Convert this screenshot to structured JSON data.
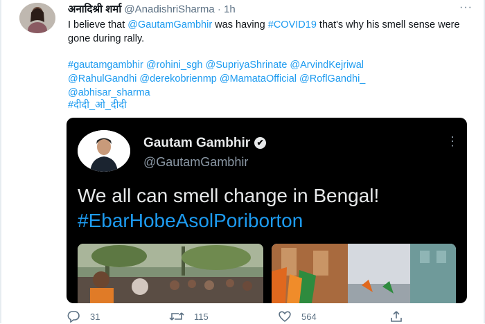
{
  "tweet": {
    "author_name": "अनादिश्री शर्मा",
    "handle": "@AnadishriSharma",
    "separator": "·",
    "time": "1h",
    "more": "···",
    "line1_pre": "I believe that ",
    "line1_mention": "@GautamGambhir",
    "line1_mid": " was having ",
    "line1_tag": "#COVID19",
    "line1_post": " that's why his smell sense were gone during rally.",
    "tags_line": [
      "#gautamgambhir @rohini_sgh @SupriyaShrinate @ArvindKejriwal",
      "@RahulGandhi @derekobrienmp @MamataOfficial @RoflGandhi_",
      "@abhisar_sharma"
    ],
    "hindi_tag": "#दीदी_ओ_दीदी"
  },
  "card": {
    "name": "Gautam Gambhir",
    "verified_glyph": "✔",
    "handle": "@GautamGambhir",
    "more": "⋮",
    "text": "We all can smell change in Bengal!",
    "hashtag": "#EbarHobeAsolPoriborton"
  },
  "actions": {
    "replies": "31",
    "retweets": "115",
    "likes": "564"
  },
  "icons": [
    "reply-icon",
    "retweet-icon",
    "like-icon",
    "share-icon",
    "verified-icon",
    "more-icon"
  ]
}
